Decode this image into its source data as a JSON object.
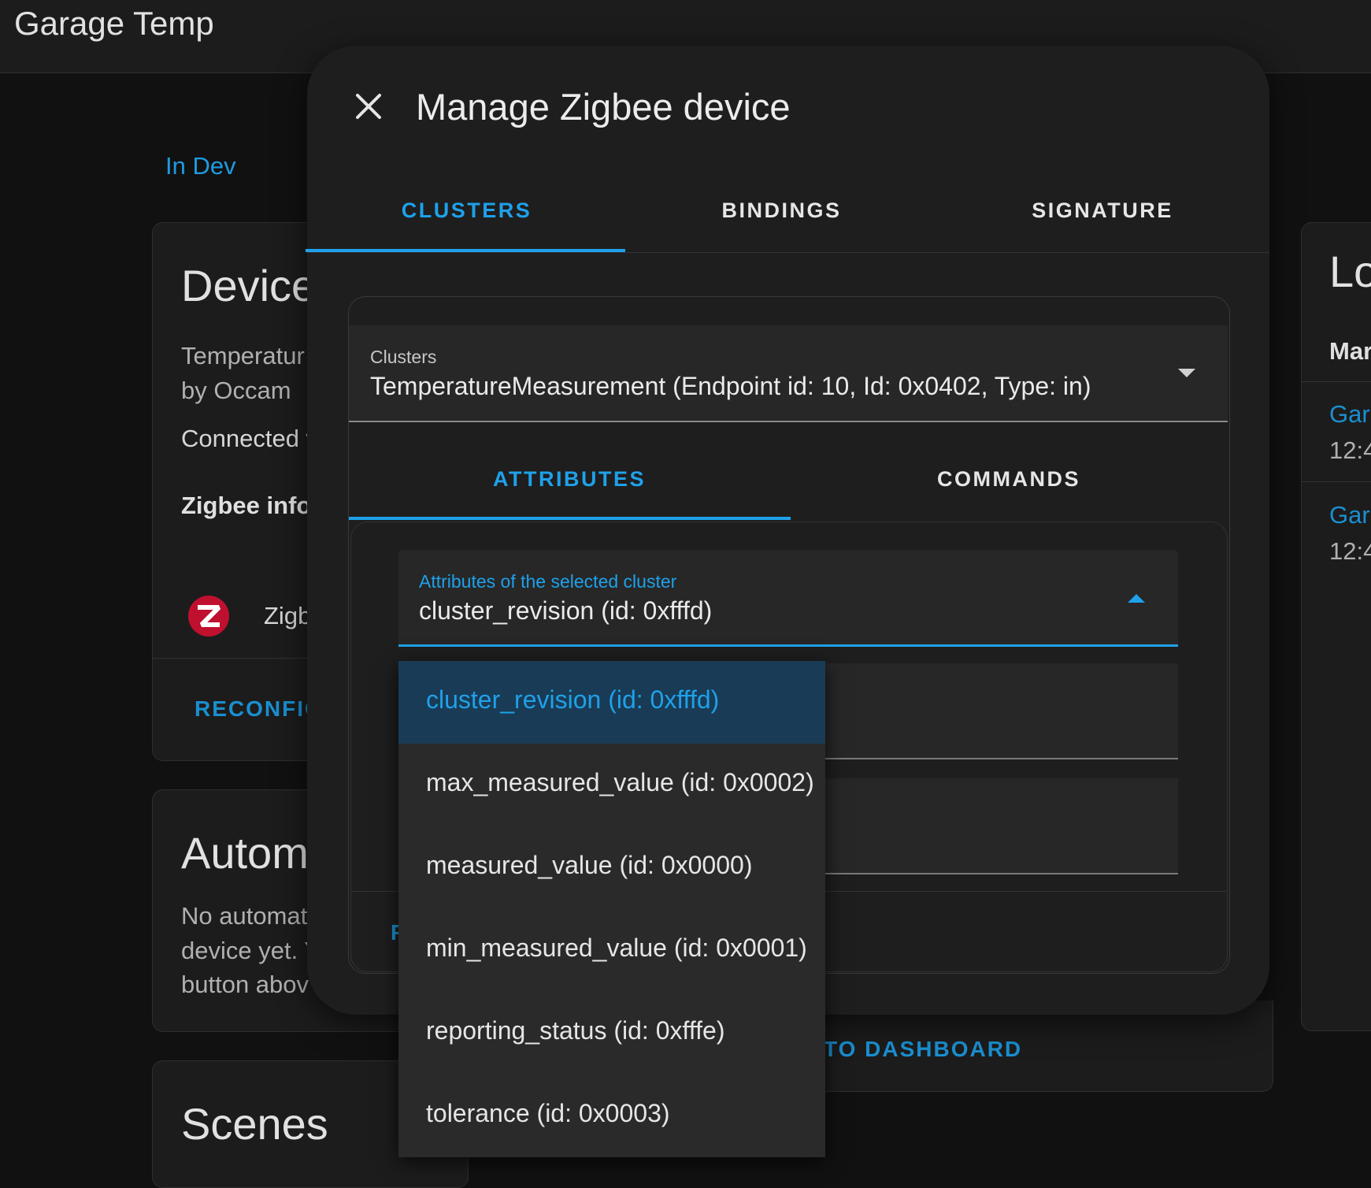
{
  "app": {
    "page_title": "Garage Temp",
    "breadcrumb": "In Dev"
  },
  "device_card": {
    "title": "Device",
    "line1": "Temperatur",
    "line2": "by Occam",
    "connected": "Connected v",
    "zigbee_info": "Zigbee info",
    "zigbee_row": "Zigb",
    "reconfigure": "RECONFIG"
  },
  "automations_card": {
    "title": "Autom",
    "line1": "No automat",
    "line2": "device yet. Y",
    "line3": "button abov"
  },
  "scenes_card": {
    "title": "Scenes"
  },
  "logbook_card": {
    "title": "Lo",
    "subtitle": "Mar",
    "entry1_name": "Gara",
    "entry1_time": "12:4",
    "entry2_name": "Gara",
    "entry2_time": "12:4"
  },
  "footer_link": "TO DASHBOARD",
  "dialog": {
    "title": "Manage Zigbee device",
    "close_icon": "close-icon",
    "tabs": [
      "CLUSTERS",
      "BINDINGS",
      "SIGNATURE"
    ],
    "active_tab": "CLUSTERS",
    "clusters_select": {
      "label": "Clusters",
      "value": "TemperatureMeasurement (Endpoint id: 10, Id: 0x0402, Type: in)"
    },
    "sub_tabs": [
      "ATTRIBUTES",
      "COMMANDS"
    ],
    "active_sub_tab": "ATTRIBUTES",
    "attributes_select": {
      "label": "Attributes of the selected cluster",
      "value": "cluster_revision (id: 0xfffd)"
    },
    "hidden_button_fragment": "F",
    "attribute_options": [
      "cluster_revision (id: 0xfffd)",
      "max_measured_value (id: 0x0002)",
      "measured_value (id: 0x0000)",
      "min_measured_value (id: 0x0001)",
      "reporting_status (id: 0xfffe)",
      "tolerance (id: 0x0003)"
    ],
    "selected_option": "cluster_revision (id: 0xfffd)"
  },
  "colors": {
    "accent": "#1ea1ea",
    "background": "#111111",
    "card": "#1c1c1c",
    "dialog": "#1e1e1e",
    "selected_row": "#1a3b55",
    "zigbee_logo": "#c0102f"
  }
}
